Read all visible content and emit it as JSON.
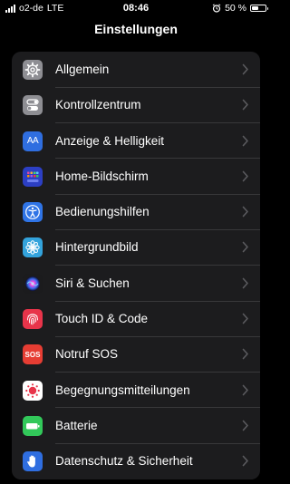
{
  "status_bar": {
    "carrier": "o2-de",
    "network": "LTE",
    "time": "08:46",
    "battery_percent": "50 %",
    "battery_level": 0.5
  },
  "nav": {
    "title": "Einstellungen"
  },
  "settings": {
    "items": [
      {
        "label": "Allgemein",
        "icon": "gear-icon",
        "color": "#8e8e93"
      },
      {
        "label": "Kontrollzentrum",
        "icon": "toggles-icon",
        "color": "#8e8e93"
      },
      {
        "label": "Anzeige & Helligkeit",
        "icon": "text-size-icon",
        "color": "#2f6ee0"
      },
      {
        "label": "Home-Bildschirm",
        "icon": "app-grid-icon",
        "color": "#2c3fc4"
      },
      {
        "label": "Bedienungshilfen",
        "icon": "accessibility-icon",
        "color": "#2f74e6"
      },
      {
        "label": "Hintergrundbild",
        "icon": "flower-icon",
        "color": "#33a3dc"
      },
      {
        "label": "Siri & Suchen",
        "icon": "siri-icon",
        "color": "#1b1b1d"
      },
      {
        "label": "Touch ID & Code",
        "icon": "fingerprint-icon",
        "color": "#e8344a"
      },
      {
        "label": "Notruf SOS",
        "icon": "sos-icon",
        "color": "#e63d33"
      },
      {
        "label": "Begegnungsmitteilungen",
        "icon": "exposure-icon",
        "color": "#ffffff"
      },
      {
        "label": "Batterie",
        "icon": "battery-icon",
        "color": "#32c85a"
      },
      {
        "label": "Datenschutz & Sicherheit",
        "icon": "hand-icon",
        "color": "#2f6ee0"
      }
    ],
    "sos_icon_text": "SOS",
    "display_icon_text": "AA"
  }
}
